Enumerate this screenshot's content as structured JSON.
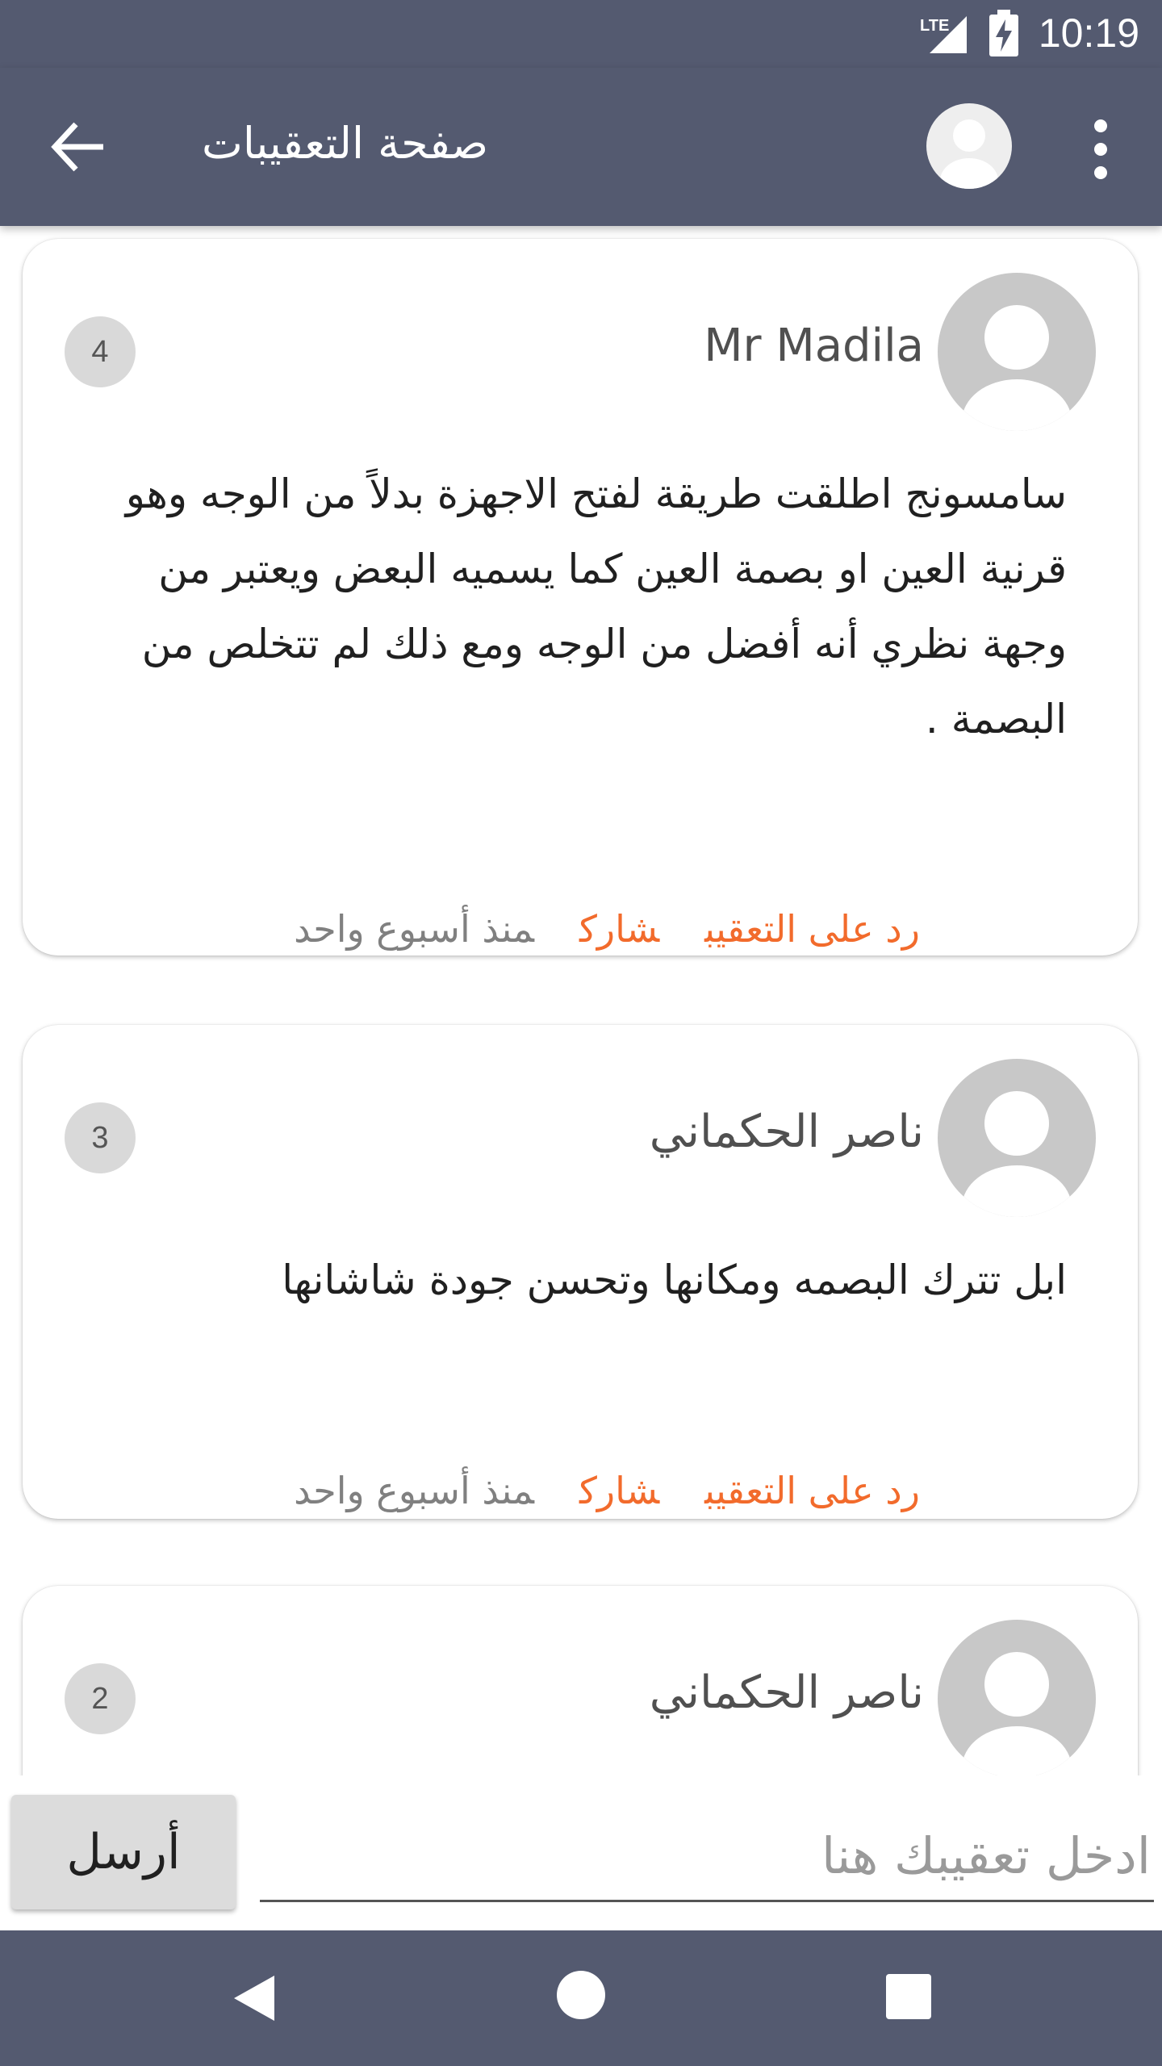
{
  "status_bar": {
    "time": "10:19",
    "network_label": "LTE",
    "icons": [
      "lte-signal-icon",
      "battery-charging-icon"
    ]
  },
  "app_bar": {
    "title": "صفحة التعقيبات",
    "icons": [
      "back-arrow-icon",
      "avatar-icon",
      "more-vert-icon"
    ],
    "color": "#545a70"
  },
  "comments": [
    {
      "name": "Mr Madila",
      "count": "4",
      "text": "سامسونج اطلقت طريقة لفتح الاجهزة بدلاً من الوجه وهو قرنية العين او بصمة العين كما يسميه البعض ويعتبر من وجهة نظري أنه أفضل من الوجه ومع ذلك لم تتخلص من البصمة .",
      "reply_label": "رد على التعقيب",
      "share_label": "شارك",
      "time": "منذ أسبوع واحد"
    },
    {
      "name": "ناصر الحكماني",
      "count": "3",
      "text": "ابل تترك البصمه ومكانها وتحسن جودة شاشانها",
      "reply_label": "رد على التعقيب",
      "share_label": "شارك",
      "time": "منذ أسبوع واحد"
    },
    {
      "name": "ناصر الحكماني",
      "count": "2"
    }
  ],
  "input_bar": {
    "send_label": "أرسل",
    "placeholder": "ادخل تعقيبك هنا",
    "value": ""
  },
  "nav_bar": {
    "icons": [
      "nav-back-icon",
      "nav-home-icon",
      "nav-recents-icon"
    ]
  },
  "colors": {
    "accent": "#f26b2c",
    "bar": "#545a70",
    "badge": "#d9d9d9"
  }
}
